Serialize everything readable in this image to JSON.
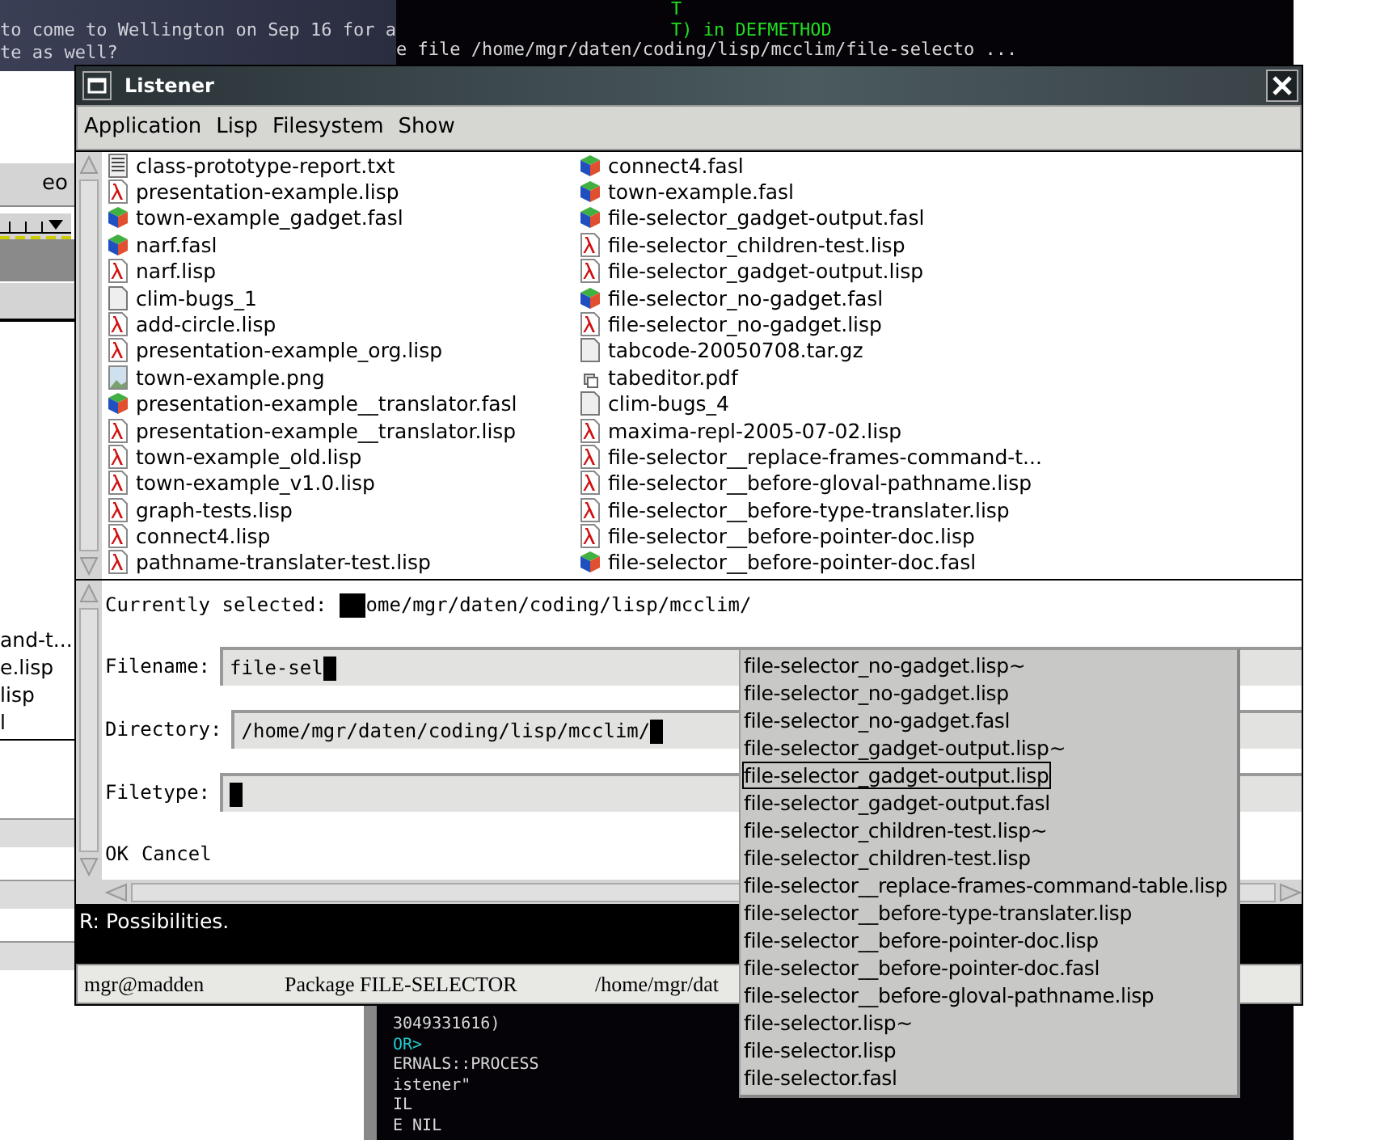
{
  "mail_window": {
    "lines": [
      "to come to Wellington on Sep 16 for a",
      "te as well?"
    ]
  },
  "top_terminal": {
    "lines": [
      {
        "text": "T",
        "color": "#22dd22"
      },
      {
        "text": "T) in DEFMETHOD",
        "color": "#22dd22"
      },
      {
        "text": "e file /home/mgr/daten/coding/lisp/mcclim/file-selecto ...",
        "color": "#d8d8d8"
      }
    ]
  },
  "side_window": {
    "button_label": "eo",
    "list_lines": [
      "and-t...",
      "e.lisp",
      "lisp",
      "l"
    ]
  },
  "bottom_terminal": {
    "lines": [
      {
        "text": "3049331616)",
        "color": "#d8d8d8"
      },
      {
        "text": "OR>",
        "color": "#22cccc"
      },
      {
        "text": "ERNALS::PROCESS",
        "color": "#d8d8d8"
      },
      {
        "text": "istener\"",
        "color": "#d8d8d8"
      },
      {
        "text": "IL",
        "color": "#d8d8d8"
      },
      {
        "text": "E NIL",
        "color": "#d8d8d8"
      }
    ]
  },
  "window": {
    "title": "Listener"
  },
  "menu": [
    "Application",
    "Lisp",
    "Filesystem",
    "Show"
  ],
  "files": [
    {
      "name": "class-prototype-report.txt",
      "kind": "text"
    },
    {
      "name": "presentation-example.lisp",
      "kind": "lisp"
    },
    {
      "name": "town-example_gadget.fasl",
      "kind": "fasl"
    },
    {
      "name": "narf.fasl",
      "kind": "fasl"
    },
    {
      "name": "narf.lisp",
      "kind": "lisp"
    },
    {
      "name": "clim-bugs_1",
      "kind": "plain"
    },
    {
      "name": "add-circle.lisp",
      "kind": "lisp"
    },
    {
      "name": "presentation-example_org.lisp",
      "kind": "lisp"
    },
    {
      "name": "town-example.png",
      "kind": "image"
    },
    {
      "name": "presentation-example__translator.fasl",
      "kind": "fasl"
    },
    {
      "name": "presentation-example__translator.lisp",
      "kind": "lisp"
    },
    {
      "name": "town-example_old.lisp",
      "kind": "lisp"
    },
    {
      "name": "town-example_v1.0.lisp",
      "kind": "lisp"
    },
    {
      "name": "graph-tests.lisp",
      "kind": "lisp"
    },
    {
      "name": "connect4.lisp",
      "kind": "lisp"
    },
    {
      "name": "pathname-translater-test.lisp",
      "kind": "lisp"
    },
    {
      "name": "connect4.fasl",
      "kind": "fasl"
    },
    {
      "name": "town-example.fasl",
      "kind": "fasl"
    },
    {
      "name": "file-selector_gadget-output.fasl",
      "kind": "fasl"
    },
    {
      "name": "file-selector_children-test.lisp",
      "kind": "lisp"
    },
    {
      "name": "file-selector_gadget-output.lisp",
      "kind": "lisp"
    },
    {
      "name": "file-selector_no-gadget.fasl",
      "kind": "fasl"
    },
    {
      "name": "file-selector_no-gadget.lisp",
      "kind": "lisp"
    },
    {
      "name": "tabcode-20050708.tar.gz",
      "kind": "plain"
    },
    {
      "name": "tabeditor.pdf",
      "kind": "pdf"
    },
    {
      "name": "clim-bugs_4",
      "kind": "plain"
    },
    {
      "name": "maxima-repl-2005-07-02.lisp",
      "kind": "lisp"
    },
    {
      "name": "file-selector__replace-frames-command-t...",
      "kind": "lisp"
    },
    {
      "name": "file-selector__before-gloval-pathname.lisp",
      "kind": "lisp"
    },
    {
      "name": "file-selector__before-type-translater.lisp",
      "kind": "lisp"
    },
    {
      "name": "file-selector__before-pointer-doc.lisp",
      "kind": "lisp"
    },
    {
      "name": "file-selector__before-pointer-doc.fasl",
      "kind": "fasl"
    }
  ],
  "form": {
    "currently_selected": {
      "label": "Currently selected:",
      "value": "ome/mgr/daten/coding/lisp/mcclim/"
    },
    "fields": [
      {
        "label": "Filename:",
        "value": "file-sel"
      },
      {
        "label": "Directory:",
        "value": "/home/mgr/daten/coding/lisp/mcclim/"
      },
      {
        "label": "Filetype:"
      }
    ],
    "buttons": [
      "OK",
      "Cancel"
    ]
  },
  "message": "R: Possibilities.",
  "status_bar": [
    "mgr@madden",
    "Package FILE-SELECTOR",
    "/home/mgr/dat"
  ],
  "popup": {
    "items": [
      {
        "label": "file-selector_no-gadget.lisp~",
        "selected": false
      },
      {
        "label": "file-selector_no-gadget.lisp",
        "selected": false
      },
      {
        "label": "file-selector_no-gadget.fasl",
        "selected": false
      },
      {
        "label": "file-selector_gadget-output.lisp~",
        "selected": false
      },
      {
        "label": "file-selector_gadget-output.lisp",
        "selected": true
      },
      {
        "label": "file-selector_gadget-output.fasl",
        "selected": false
      },
      {
        "label": "file-selector_children-test.lisp~",
        "selected": false
      },
      {
        "label": "file-selector_children-test.lisp",
        "selected": false
      },
      {
        "label": "file-selector__replace-frames-command-table.lisp",
        "selected": false
      },
      {
        "label": "file-selector__before-type-translater.lisp",
        "selected": false
      },
      {
        "label": "file-selector__before-pointer-doc.lisp",
        "selected": false
      },
      {
        "label": "file-selector__before-pointer-doc.fasl",
        "selected": false
      },
      {
        "label": "file-selector__before-gloval-pathname.lisp",
        "selected": false
      },
      {
        "label": "file-selector.lisp~",
        "selected": false
      },
      {
        "label": "file-selector.lisp",
        "selected": false
      },
      {
        "label": "file-selector.fasl",
        "selected": false
      }
    ]
  }
}
